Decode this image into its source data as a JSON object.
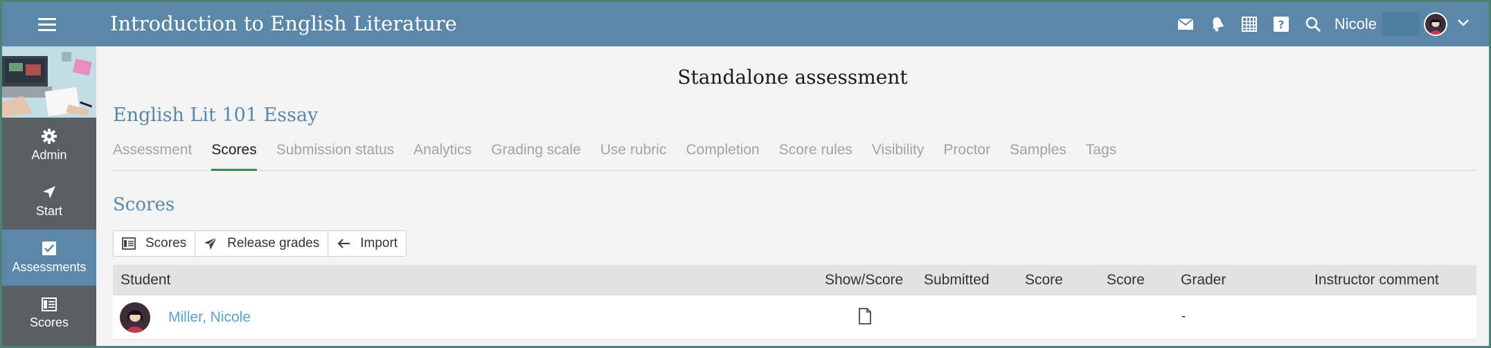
{
  "app": {
    "title": "Introduction to English Literature",
    "user_name": "Nicole"
  },
  "top_icons": [
    "mail-icon",
    "bell-icon",
    "calendar-icon",
    "help-icon",
    "search-icon"
  ],
  "sidebar": {
    "items": [
      {
        "label": "Admin",
        "icon": "gear-icon"
      },
      {
        "label": "Start",
        "icon": "navigation-arrow-icon"
      },
      {
        "label": "Assessments",
        "icon": "checkbox-icon",
        "active": true
      },
      {
        "label": "Scores",
        "icon": "gradebook-icon"
      }
    ]
  },
  "page": {
    "heading": "Standalone assessment",
    "assessment_title": "English Lit 101 Essay",
    "section_title": "Scores"
  },
  "tabs": [
    {
      "label": "Assessment"
    },
    {
      "label": "Scores",
      "active": true
    },
    {
      "label": "Submission status"
    },
    {
      "label": "Analytics"
    },
    {
      "label": "Grading scale"
    },
    {
      "label": "Use rubric"
    },
    {
      "label": "Completion"
    },
    {
      "label": "Score rules"
    },
    {
      "label": "Visibility"
    },
    {
      "label": "Proctor"
    },
    {
      "label": "Samples"
    },
    {
      "label": "Tags"
    }
  ],
  "toolbar": {
    "scores_label": "Scores",
    "release_label": "Release grades",
    "import_label": "Import"
  },
  "table": {
    "headers": {
      "student": "Student",
      "show_score": "Show/Score",
      "submitted": "Submitted",
      "score1": "Score",
      "score2": "Score",
      "grader": "Grader",
      "comment": "Instructor comment"
    },
    "rows": [
      {
        "student": "Miller, Nicole",
        "submitted": "",
        "score1": "",
        "score2": "",
        "grader": "-",
        "comment": ""
      }
    ]
  },
  "colors": {
    "accent": "#5b87a8",
    "sidebar": "#5a5f66",
    "active_tab": "#2e8b57",
    "link": "#5b9fd0"
  }
}
